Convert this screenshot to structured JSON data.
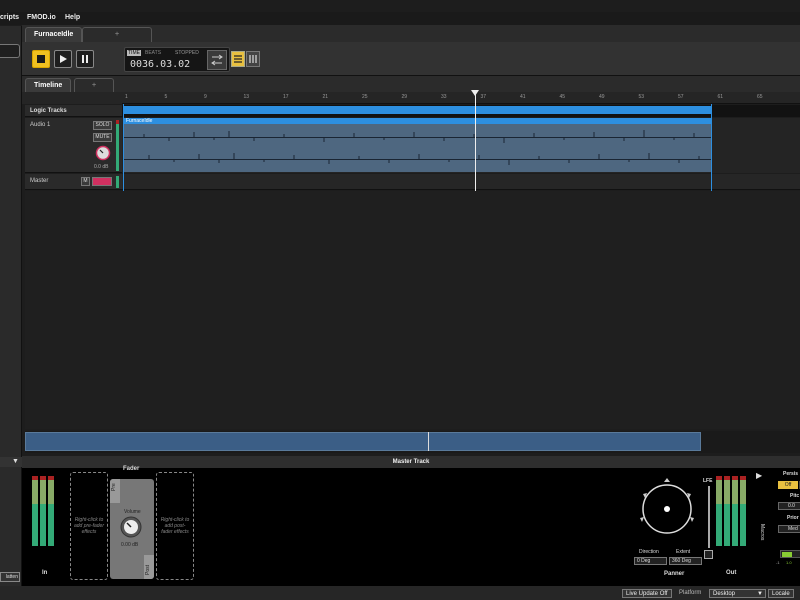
{
  "menu": {
    "items": [
      "cripts",
      "FMOD.io",
      "Help"
    ]
  },
  "tabs": {
    "active": "FurnaceIdle",
    "add": "+"
  },
  "transport": {
    "time_mode": "TIME",
    "beats_mode": "BEATS",
    "state": "STOPPED",
    "time": "0036.03.02"
  },
  "subtabs": {
    "timeline": "Timeline",
    "add": "+"
  },
  "ruler": {
    "ticks": [
      "1",
      "5",
      "9",
      "13",
      "17",
      "21",
      "25",
      "29",
      "33",
      "37",
      "41",
      "45",
      "49",
      "53",
      "57",
      "61",
      "65"
    ]
  },
  "tracks": {
    "logic_label": "Logic Tracks",
    "audio": {
      "name": "Audio 1",
      "solo": "SOLO",
      "mute": "MUTE",
      "gain": "0.0 dB",
      "region": "FurnaceIdle"
    },
    "master": {
      "name": "Master",
      "mute": "M"
    }
  },
  "mixer": {
    "title": "Master Track",
    "in_label": "In",
    "out_label": "Out",
    "pre_fader_hint": "Right-click to add pre-fader effects",
    "post_fader_hint": "Right-click to add post-fader effects",
    "fader_title": "Fader",
    "pre": "Pre",
    "post": "Post",
    "volume_label": "Volume",
    "volume_value": "0.00 dB",
    "panner": {
      "label": "Panner",
      "direction_label": "Direction",
      "direction_value": "0 Deg",
      "extent_label": "Extent",
      "extent_value": "360 Deg",
      "lfe": "LFE"
    },
    "macros": "Macros",
    "props": {
      "persist": "Persis",
      "off": "Off",
      "pitch": "Pitc",
      "pitch_val": "0.0",
      "priority": "Prior",
      "priority_val": "Med",
      "min_val": "-1",
      "max_val": "1.0"
    }
  },
  "status": {
    "live_update": "Live Update Off",
    "platform_label": "Platform",
    "platform": "Desktop",
    "locale": "Locale",
    "flatten": "latten"
  }
}
